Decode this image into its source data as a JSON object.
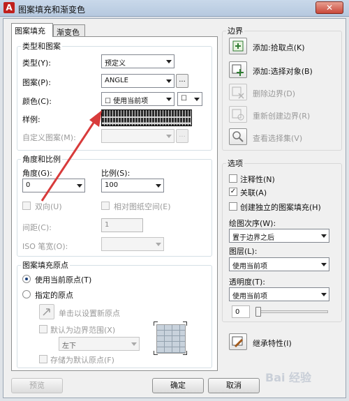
{
  "window": {
    "title": "图案填充和渐变色",
    "close_glyph": "✕"
  },
  "tabs": [
    {
      "label": "图案填充"
    },
    {
      "label": "渐变色"
    }
  ],
  "type_pattern": {
    "title": "类型和图案",
    "type_label": "类型(Y):",
    "type_value": "预定义",
    "pattern_label": "图案(P):",
    "pattern_value": "ANGLE",
    "dots": "...",
    "color_label": "颜色(C):",
    "color_value": "☐ 使用当前项",
    "color_bg_value": "☐",
    "sample_label": "样例:",
    "custom_label": "自定义图案(M):"
  },
  "angle_scale": {
    "title": "角度和比例",
    "angle_label": "角度(G):",
    "angle_value": "0",
    "scale_label": "比例(S):",
    "scale_value": "100",
    "bidirectional_label": "双向(U)",
    "relative_label": "相对图纸空间(E)",
    "spacing_label": "间距(C):",
    "spacing_value": "1",
    "iso_label": "ISO 笔宽(O):"
  },
  "origin": {
    "title": "图案填充原点",
    "use_current_label": "使用当前原点(T)",
    "specified_label": "指定的原点",
    "click_set_label": "单击以设置新原点",
    "default_extent_label": "默认为边界范围(X)",
    "position_value": "左下",
    "store_default_label": "存储为默认原点(F)"
  },
  "boundaries": {
    "title": "边界",
    "add_pick_label": "添加:拾取点(K)",
    "add_select_label": "添加:选择对象(B)",
    "remove_label": "删除边界(D)",
    "recreate_label": "重新创建边界(R)",
    "view_label": "查看选择集(V)"
  },
  "options": {
    "title": "选项",
    "annotative_label": "注释性(N)",
    "associative_label": "关联(A)",
    "independent_label": "创建独立的图案填充(H)",
    "draw_order_label": "绘图次序(W):",
    "draw_order_value": "置于边界之后",
    "layer_label": "图层(L):",
    "layer_value": "使用当前项",
    "transparency_label": "透明度(T):",
    "transparency_value": "使用当前项",
    "transparency_level": "0",
    "checkmark": "✓"
  },
  "inherit_label": "继承特性(I)",
  "buttons": {
    "preview": "预览",
    "ok": "确定",
    "cancel": "取消"
  },
  "watermark": "Bai 经验"
}
